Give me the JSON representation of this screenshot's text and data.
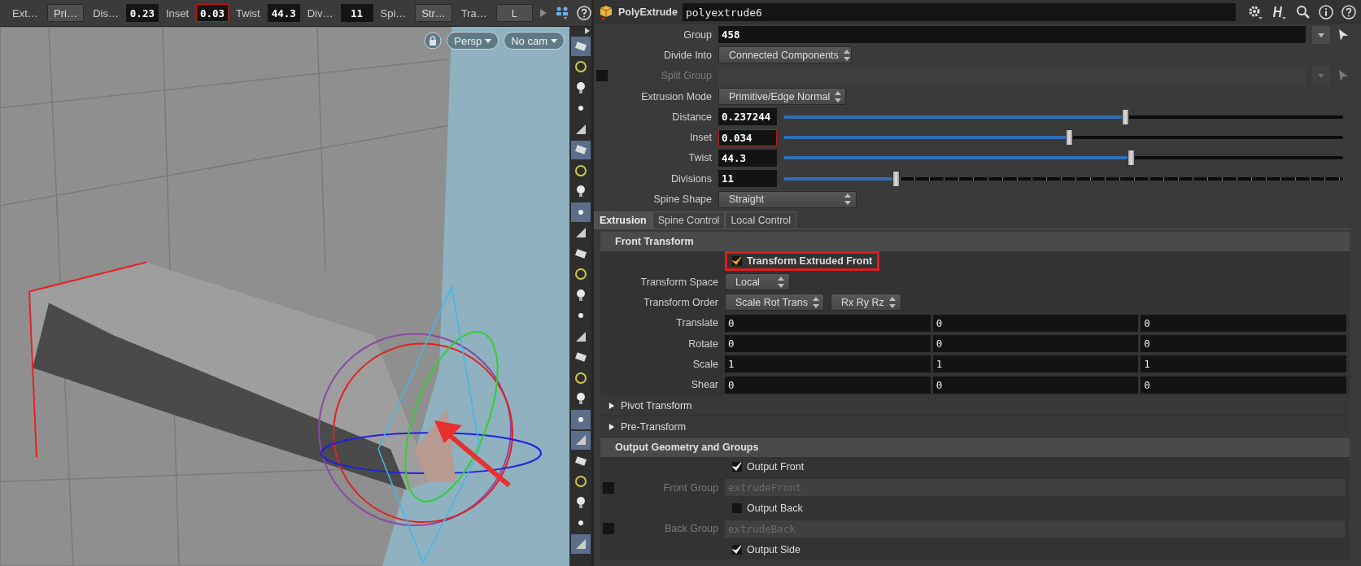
{
  "toolbar": {
    "items": [
      {
        "kind": "label",
        "text": "Ext…"
      },
      {
        "kind": "menu",
        "text": "Pri…"
      },
      {
        "kind": "label",
        "text": "Dis…"
      },
      {
        "kind": "field",
        "text": "0.23",
        "flagged": false
      },
      {
        "kind": "label",
        "text": "Inset"
      },
      {
        "kind": "field",
        "text": "0.03",
        "flagged": true
      },
      {
        "kind": "label",
        "text": "Twist"
      },
      {
        "kind": "field",
        "text": "44.3",
        "flagged": false
      },
      {
        "kind": "label",
        "text": "Div…"
      },
      {
        "kind": "field",
        "text": "11",
        "flagged": false
      },
      {
        "kind": "label",
        "text": "Spi…"
      },
      {
        "kind": "menu",
        "text": "Str…"
      },
      {
        "kind": "label",
        "text": "Tra…"
      },
      {
        "kind": "menu",
        "text": "L"
      }
    ]
  },
  "viewport": {
    "camera_menus": [
      "Persp",
      "No cam"
    ]
  },
  "tools": [
    {
      "selected": true
    },
    {
      "selected": false
    },
    {
      "selected": false
    },
    {
      "selected": false
    },
    {
      "selected": false
    },
    {
      "selected": true
    },
    {
      "selected": false
    },
    {
      "selected": false
    },
    {
      "selected": true
    },
    {
      "selected": false
    },
    {
      "selected": false
    },
    {
      "selected": false
    },
    {
      "selected": false
    },
    {
      "selected": false
    },
    {
      "selected": false
    },
    {
      "selected": false
    },
    {
      "selected": false
    },
    {
      "selected": false
    },
    {
      "selected": true
    },
    {
      "selected": true
    },
    {
      "selected": false
    },
    {
      "selected": false
    },
    {
      "selected": false
    },
    {
      "selected": false
    },
    {
      "selected": true
    }
  ],
  "node": {
    "type": "PolyExtrude",
    "name": "polyextrude6"
  },
  "params": [
    {
      "kind": "string",
      "label": "Group",
      "value": "458",
      "disabled": false
    },
    {
      "kind": "menu",
      "label": "Divide Into",
      "value": "Connected Components"
    },
    {
      "kind": "string",
      "label": "Split Group",
      "disabled": true,
      "toggle": false
    },
    {
      "kind": "menu",
      "label": "Extrusion Mode",
      "value": "Primitive/Edge Normal"
    },
    {
      "kind": "slider",
      "label": "Distance",
      "value": "0.237244",
      "level": 0.61,
      "flagged": false
    },
    {
      "kind": "slider",
      "label": "Inset",
      "value": "0.034",
      "level": 0.51,
      "flagged": true
    },
    {
      "kind": "slider",
      "label": "Twist",
      "value": "44.3",
      "level": 0.62,
      "flagged": false
    },
    {
      "kind": "slider",
      "label": "Divisions",
      "value": "11",
      "level": 0.2,
      "flagged": false
    },
    {
      "kind": "menu",
      "label": "Spine Shape",
      "value": "Straight"
    }
  ],
  "tabs": [
    {
      "label": "Extrusion",
      "selected": true
    },
    {
      "label": "Spine Control",
      "selected": false
    },
    {
      "label": "Local Control",
      "selected": false
    }
  ],
  "sections": [
    {
      "kind": "folder",
      "title": "Front Transform",
      "rows": [
        {
          "kind": "checkbox",
          "label": "Transform Extruded Front",
          "checked": true,
          "highlighted": true
        },
        {
          "kind": "menus",
          "label": "Transform Space",
          "values": [
            "Local"
          ]
        },
        {
          "kind": "menus",
          "label": "Transform Order",
          "values": [
            "Scale Rot Trans",
            "Rx Ry Rz"
          ]
        },
        {
          "kind": "vector",
          "label": "Translate",
          "values": [
            "0",
            "0",
            "0"
          ]
        },
        {
          "kind": "vector",
          "label": "Rotate",
          "values": [
            "0",
            "0",
            "0"
          ]
        },
        {
          "kind": "vector",
          "label": "Scale",
          "values": [
            "1",
            "1",
            "1"
          ]
        },
        {
          "kind": "vector",
          "label": "Shear",
          "values": [
            "0",
            "0",
            "0"
          ]
        }
      ]
    },
    {
      "kind": "collapsible",
      "title": "Pivot Transform",
      "expanded": false
    },
    {
      "kind": "collapsible",
      "title": "Pre-Transform",
      "expanded": false
    },
    {
      "kind": "folder",
      "title": "Output Geometry and Groups",
      "rows": [
        {
          "kind": "checkbox",
          "label": "Output Front",
          "checked": true,
          "highlighted": false
        },
        {
          "kind": "string",
          "label": "Front Group",
          "placeholder": "extrudeFront",
          "toggle": false
        },
        {
          "kind": "checkbox",
          "label": "Output Back",
          "checked": false,
          "highlighted": false
        },
        {
          "kind": "string",
          "label": "Back Group",
          "placeholder": "extrudeBack",
          "toggle": false
        },
        {
          "kind": "checkbox",
          "label": "Output Side",
          "checked": true,
          "highlighted": false
        }
      ]
    }
  ]
}
